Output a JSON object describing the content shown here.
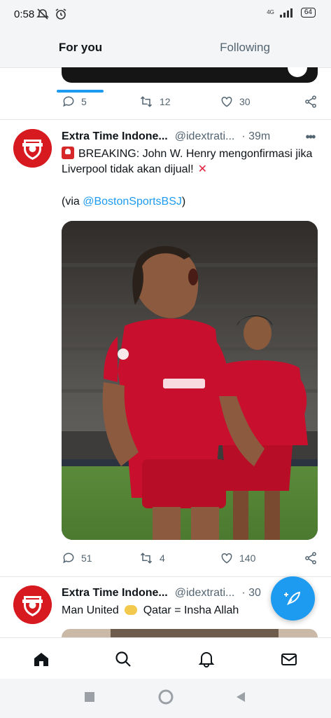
{
  "status_bar": {
    "time": "0:58",
    "battery": "64",
    "network": "4G"
  },
  "tabs": [
    {
      "label": "For you",
      "selected": true
    },
    {
      "label": "Following",
      "selected": false
    }
  ],
  "colors": {
    "accent": "#1d9bf0",
    "text": "#0f1419",
    "muted": "#536471",
    "brand_red": "#d71920"
  },
  "previous_tweet": {
    "actions": {
      "replies": "5",
      "retweets": "12",
      "likes": "30"
    }
  },
  "tweets": [
    {
      "name": "Extra Time Indone...",
      "handle": "@idextrati...",
      "time": "· 39m",
      "text_line1": "BREAKING: John W. Henry mengonfirmasi jika Liverpool tidak akan dijual!",
      "text_via_prefix": "(via ",
      "text_via_mention": "@BostonSportsBSJ",
      "text_via_suffix": ")",
      "actions": {
        "replies": "51",
        "retweets": "4",
        "likes": "140"
      }
    },
    {
      "name": "Extra Time Indone...",
      "handle": "@idextrati...",
      "time": "· 30",
      "text_before": "Man United",
      "text_after": "Qatar = Insha Allah"
    }
  ],
  "icons": {
    "reply": "reply-icon",
    "retweet": "retweet-icon",
    "like": "like-icon",
    "share": "share-icon",
    "home": "home-icon",
    "search": "search-icon",
    "notifications": "bell-icon",
    "messages": "mail-icon",
    "compose": "compose-icon"
  }
}
